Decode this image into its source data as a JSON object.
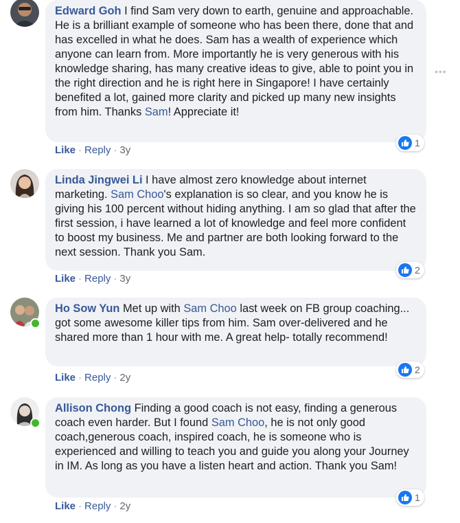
{
  "comments": [
    {
      "author": "Edward Goh",
      "parts": [
        {
          "t": "text",
          "v": " I find Sam very down to earth, genuine and approachable. He is a brilliant example of someone who has been there, done that and has excelled in what he does. Sam has a wealth of experience which anyone can learn from. More importantly he is very generous with his knowledge sharing, has many creative ideas to give, able to point you in the right direction and he is right here in Singapore! I have certainly benefited a lot, gained more clarity and picked up many new insights from him. Thanks "
        },
        {
          "t": "mention",
          "v": "Sam"
        },
        {
          "t": "text",
          "v": "! Appreciate it!"
        }
      ],
      "like_label": "Like",
      "reply_label": "Reply",
      "time": "3y",
      "reactions": "1"
    },
    {
      "author": "Linda Jingwei Li",
      "parts": [
        {
          "t": "text",
          "v": " I have almost zero knowledge about internet marketing. "
        },
        {
          "t": "mention",
          "v": "Sam Choo"
        },
        {
          "t": "text",
          "v": "'s explanation is so clear, and you know he is giving his 100 percent without hiding anything. I am so glad that after the first session, i have learned a lot of knowledge and feel more confident to boost my business. Me and partner are both looking forward to the next session. Thank you Sam."
        }
      ],
      "like_label": "Like",
      "reply_label": "Reply",
      "time": "3y",
      "reactions": "2"
    },
    {
      "author": "Ho Sow Yun",
      "parts": [
        {
          "t": "text",
          "v": " Met up with "
        },
        {
          "t": "mention",
          "v": "Sam Choo"
        },
        {
          "t": "text",
          "v": " last week on FB group coaching... got some awesome killer tips from him. Sam over-delivered and he shared more than 1 hour with me. A great help- totally recommend!"
        }
      ],
      "like_label": "Like",
      "reply_label": "Reply",
      "time": "2y",
      "reactions": "2"
    },
    {
      "author": "Allison Chong",
      "parts": [
        {
          "t": "text",
          "v": " Finding a good coach is not easy, finding a generous coach even harder. But I found "
        },
        {
          "t": "mention",
          "v": "Sam Choo"
        },
        {
          "t": "text",
          "v": ", he is not only good coach,generous coach, inspired coach, he is someone who is experienced and willing to teach you and guide you along your Journey in IM. As long as you have a listen heart and action. Thank you Sam!"
        }
      ],
      "like_label": "Like",
      "reply_label": "Reply",
      "time": "2y",
      "reactions": "1"
    }
  ],
  "colors": {
    "link": "#385898",
    "bubble": "#f0f2f5",
    "like_badge": "#1877f2",
    "online": "#42b72a"
  },
  "icons": {
    "reaction": "thumbs-up-icon",
    "menu": "more-options-icon"
  },
  "menu_glyph": "•••"
}
